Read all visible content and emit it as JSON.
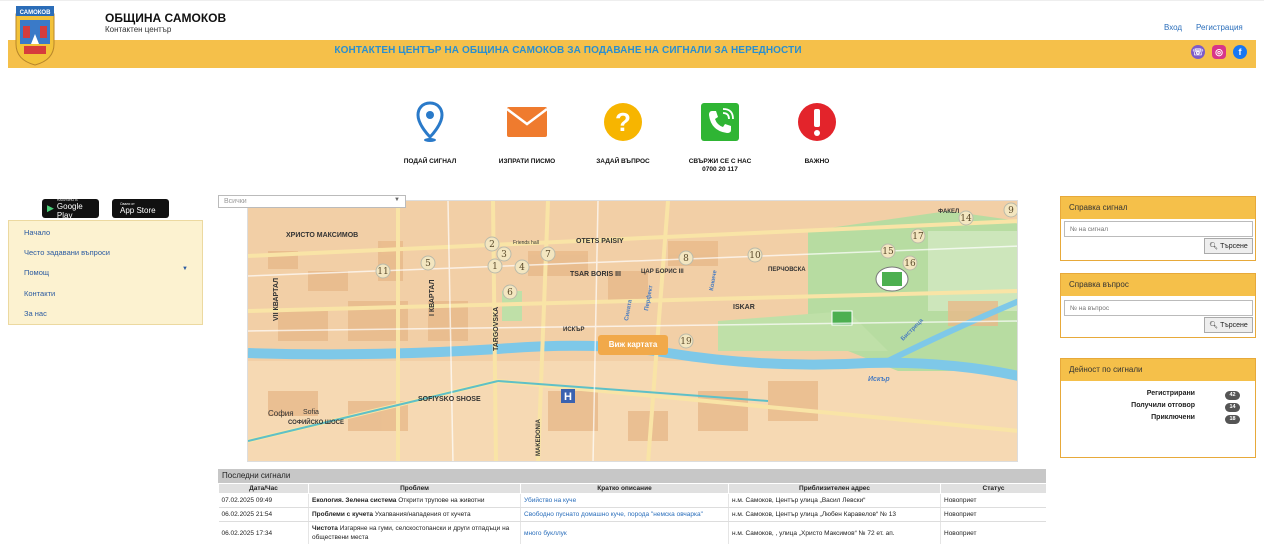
{
  "header": {
    "title": "ОБЩИНА САМОКОВ",
    "subtitle": "Контактен център",
    "logo_text": "САМОКОВ",
    "login": "Вход",
    "register": "Регистрация"
  },
  "banner": {
    "text": "КОНТАКТЕН ЦЕНТЪР НА ОБЩИНА САМОКОВ ЗА ПОДАВАНЕ НА СИГНАЛИ ЗА НЕРЕДНОСТИ",
    "social": [
      "viber-icon",
      "instagram-icon",
      "facebook-icon"
    ]
  },
  "actions": [
    {
      "label": "ПОДАЙ СИГНАЛ",
      "icon": "map-pin-icon"
    },
    {
      "label": "ИЗПРАТИ ПИСМО",
      "icon": "envelope-icon"
    },
    {
      "label": "ЗАДАЙ ВЪПРОС",
      "icon": "question-icon"
    },
    {
      "label": "СВЪРЖИ СЕ С НАС",
      "label2": "0700 20 117",
      "icon": "phone-icon"
    },
    {
      "label": "ВАЖНО",
      "icon": "exclamation-icon"
    }
  ],
  "stores": {
    "google_small": "НАЛИЧНО В",
    "google_big": "Google Play",
    "apple_small": "Свали от",
    "apple_big": "App Store"
  },
  "sidebar": {
    "items": [
      "Начало",
      "Често задавани въпроси",
      "Помощ",
      "Контакти",
      "За нас"
    ]
  },
  "map": {
    "select_value": "Всички",
    "button": "Виж картата",
    "streets": [
      "ХРИСТО МАКСИМОВ",
      "VII КВАРТАЛ",
      "I КВАРТАЛ",
      "TARGOVSKA",
      "OTETS PAISIY",
      "TSAR BORIS III",
      "ЦАР БОРИС III",
      "ISKAR",
      "ИСКЪР",
      "SOFIYSKO SHOSE",
      "СОФИЙСКО ШОСЕ",
      "София",
      "Sofia",
      "MAKEDONIA",
      "ПЕРЧОВСКА",
      "Кокиче",
      "Сината",
      "Перфект",
      "Бистрица",
      "Искър",
      "ФАКЕЛ",
      "Friends hall"
    ],
    "markers": [
      "1",
      "2",
      "3",
      "4",
      "5",
      "6",
      "7",
      "8",
      "9",
      "10",
      "11",
      "14",
      "15",
      "16",
      "17",
      "19"
    ]
  },
  "recent": {
    "title": "Последни сигнали",
    "columns": [
      "Дата/Час",
      "Проблем",
      "Кратко описание",
      "Приблизителен адрес",
      "Статус"
    ],
    "rows": [
      {
        "date": "07.02.2025 09:49",
        "category": "Екология. Зелена система",
        "problem": "Открити трупове на животни",
        "description": "Убийство на куче",
        "address": "н.м. Самоков, Център улица „Васил Левски“",
        "status": "Новоприет"
      },
      {
        "date": "06.02.2025 21:54",
        "category": "Проблеми с кучета",
        "problem": "Ухапвания/нападения от кучета",
        "description": "Свободно пуснато домашно куче, порода \"немска овчарка\"",
        "address": "н.м. Самоков, Център улица „Любен Каравелов“ № 13",
        "status": "Новоприет"
      },
      {
        "date": "06.02.2025 17:34",
        "category": "Чистота",
        "problem": "Изгаряне на гуми, селскостопански и други отпадъци на обществени места",
        "description": "много букллук",
        "address": "н.м. Самоков, , улица „Христо Максимов“ № 72 ет. ап.",
        "status": "Новоприет"
      }
    ]
  },
  "signal_lookup": {
    "title": "Справка сигнал",
    "placeholder": "№ на сигнал",
    "button": "Търсене"
  },
  "question_lookup": {
    "title": "Справка въпрос",
    "placeholder": "№ на въпрос",
    "button": "Търсене"
  },
  "activity": {
    "title": "Дейност по сигнали",
    "stats": [
      {
        "label": "Регистрирани",
        "value": 42
      },
      {
        "label": "Получили отговор",
        "value": 14
      },
      {
        "label": "Приключени",
        "value": 18
      }
    ]
  },
  "colors": {
    "accent": "#f5c04a",
    "link": "#2a6ebb",
    "banner_text": "#2a8fd0"
  }
}
